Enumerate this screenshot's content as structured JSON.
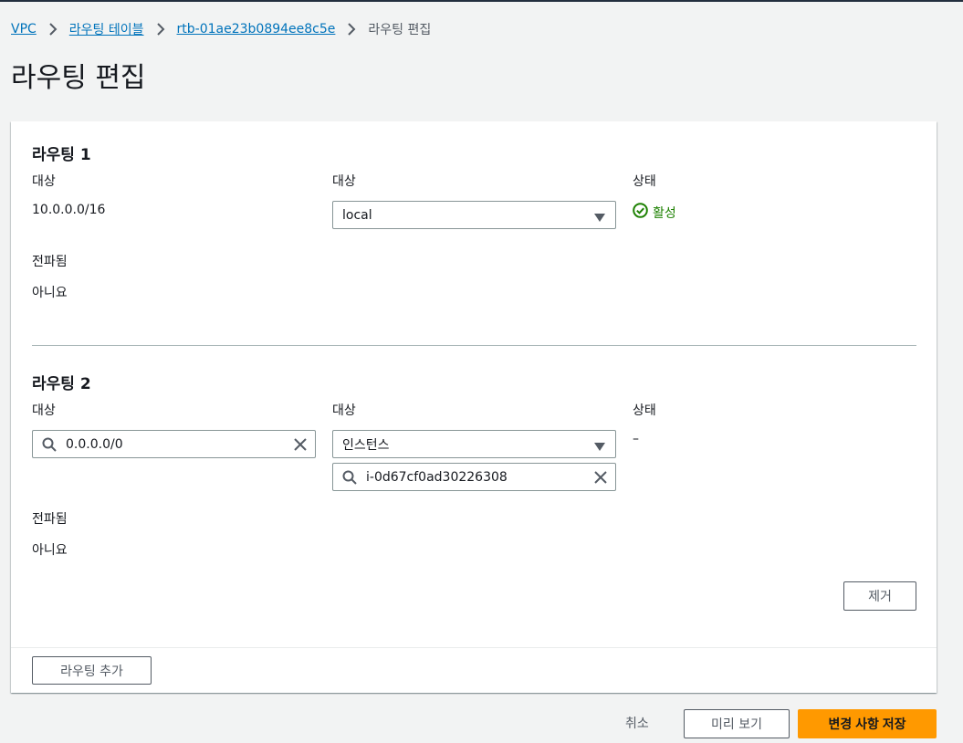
{
  "breadcrumb": {
    "items": [
      "VPC",
      "라우팅 테이블",
      "rtb-01ae23b0894ee8c5e"
    ],
    "current": "라우팅 편집"
  },
  "page": {
    "title": "라우팅 편집"
  },
  "routes": [
    {
      "title": "라우팅 1",
      "destination_label": "대상",
      "destination_value": "10.0.0.0/16",
      "target_label": "대상",
      "target_selected": "local",
      "status_label": "상태",
      "status_value": "활성",
      "propagated_label": "전파됨",
      "propagated_value": "아니요"
    },
    {
      "title": "라우팅 2",
      "destination_label": "대상",
      "destination_value": "0.0.0.0/0",
      "target_label": "대상",
      "target_selected": "인스턴스",
      "target_search_value": "i-0d67cf0ad30226308",
      "status_label": "상태",
      "status_value": "–",
      "propagated_label": "전파됨",
      "propagated_value": "아니요",
      "remove_label": "제거"
    }
  ],
  "actions": {
    "add_route": "라우팅 추가",
    "cancel": "취소",
    "preview": "미리 보기",
    "save": "변경 사항 저장"
  },
  "colors": {
    "link": "#0073bb",
    "success": "#1d8102",
    "primary": "#ff9900",
    "text": "#16191f"
  },
  "icons": [
    "chevron-right-icon",
    "caret-down-icon",
    "search-icon",
    "clear-icon",
    "status-success-icon"
  ]
}
